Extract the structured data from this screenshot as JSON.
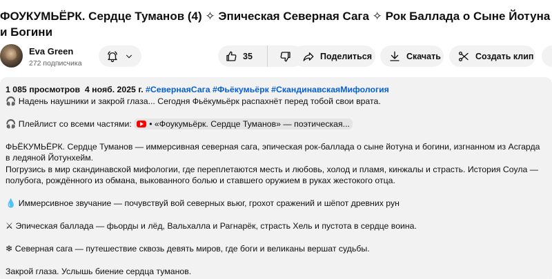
{
  "video": {
    "title": "ФОУКУМЬЁРК. Сердце Туманов (4) ✧ Эпическая Северная Сага ✧ Рок Баллада о Сыне Йотуна и Богини"
  },
  "channel": {
    "name": "Eva Green",
    "subscribers": "272 подписчика"
  },
  "actions": {
    "likes": "35",
    "share_label": "Поделиться",
    "download_label": "Скачать",
    "clip_label": "Создать клип"
  },
  "description": {
    "views": "1 085 просмотров",
    "date": "4 нояб. 2025 г.",
    "tags": "#СевернаяСага #Фьёкумьёрк #СкандинавскаяМифология",
    "line1": "🎧 Надень наушники и закрой глаза... Сегодня Фьёкумьёрк распахнёт перед тобой свои врата.",
    "playlist_label": "🎧 Плейлист со всеми частями:",
    "playlist_link": "• «Фоукумьёрк. Сердце Туманов» — поэтическая...",
    "para1": "ФЬЁКУМЬЁРК. Сердце Туманов — иммерсивная северная сага, эпическая рок-баллада о сыне йотуна и богини, изгнанном из Асгарда в ледяной Йотунхейм.",
    "para2": "Погрузись в мир скандинавской мифологии, где переплетаются месть и любовь, холод и пламя, кинжалы и страсть. История Соула — полубога, рождённого из обмана, выкованного болью и ставшего оружием в руках жестокого отца.",
    "bullet1": "💧 Иммерсивное звучание — почувствуй вой северных вьюг, грохот сражений и шёпот древних рун",
    "bullet2": "⚔ Эпическая баллада — фьорды и лёд, Вальхалла и Рагнарёк, страсть Хель и пустота в сердце воина.",
    "bullet3": "❄ Северная сага — путешествие сквозь девять миров, где боги и великаны вершат судьбы.",
    "closing": "Закрой глаза. Услышь биение сердца туманов."
  },
  "icons": {
    "bell": "bell-icon",
    "chevron": "chevron-down-icon",
    "like": "thumbs-up-icon",
    "dislike": "thumbs-down-icon",
    "share": "share-arrow-icon",
    "download": "download-icon",
    "clip": "scissors-icon",
    "more": "more-icon",
    "youtube": "youtube-icon"
  }
}
